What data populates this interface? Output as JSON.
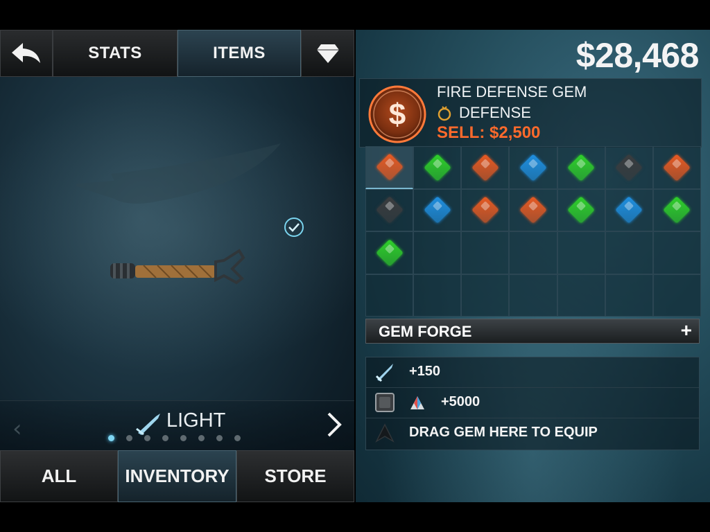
{
  "top_nav": {
    "tabs": [
      {
        "label": ""
      },
      {
        "label": "STATS"
      },
      {
        "label": "ITEMS"
      },
      {
        "label": ""
      }
    ]
  },
  "category": {
    "label": "LIGHT",
    "page_count": 8,
    "active_page": 0
  },
  "bottom_nav": {
    "tabs": [
      {
        "label": "ALL"
      },
      {
        "label": "INVENTORY"
      },
      {
        "label": "STORE"
      }
    ]
  },
  "currency": "$28,468",
  "selected_gem": {
    "name": "FIRE DEFENSE GEM",
    "type": "DEFENSE",
    "sell_text": "SELL: $2,500",
    "coin_symbol": "$"
  },
  "gem_colors": {
    "orange": "#e85a22",
    "green": "#2fd02a",
    "blue": "#1f8fe0",
    "black": "#3a3c3e"
  },
  "gem_grid": [
    "orange",
    "green",
    "orange",
    "blue",
    "green",
    "black",
    "orange",
    "black",
    "blue",
    "orange",
    "orange",
    "green",
    "blue",
    "green",
    "green",
    "",
    "",
    "",
    "",
    "",
    "",
    "",
    "",
    "",
    "",
    "",
    "",
    ""
  ],
  "gem_forge": {
    "label": "GEM FORGE",
    "plus": "+"
  },
  "slots": [
    {
      "value": "+150"
    },
    {
      "value": "+5000"
    },
    {
      "value": "DRAG GEM HERE TO EQUIP"
    }
  ]
}
